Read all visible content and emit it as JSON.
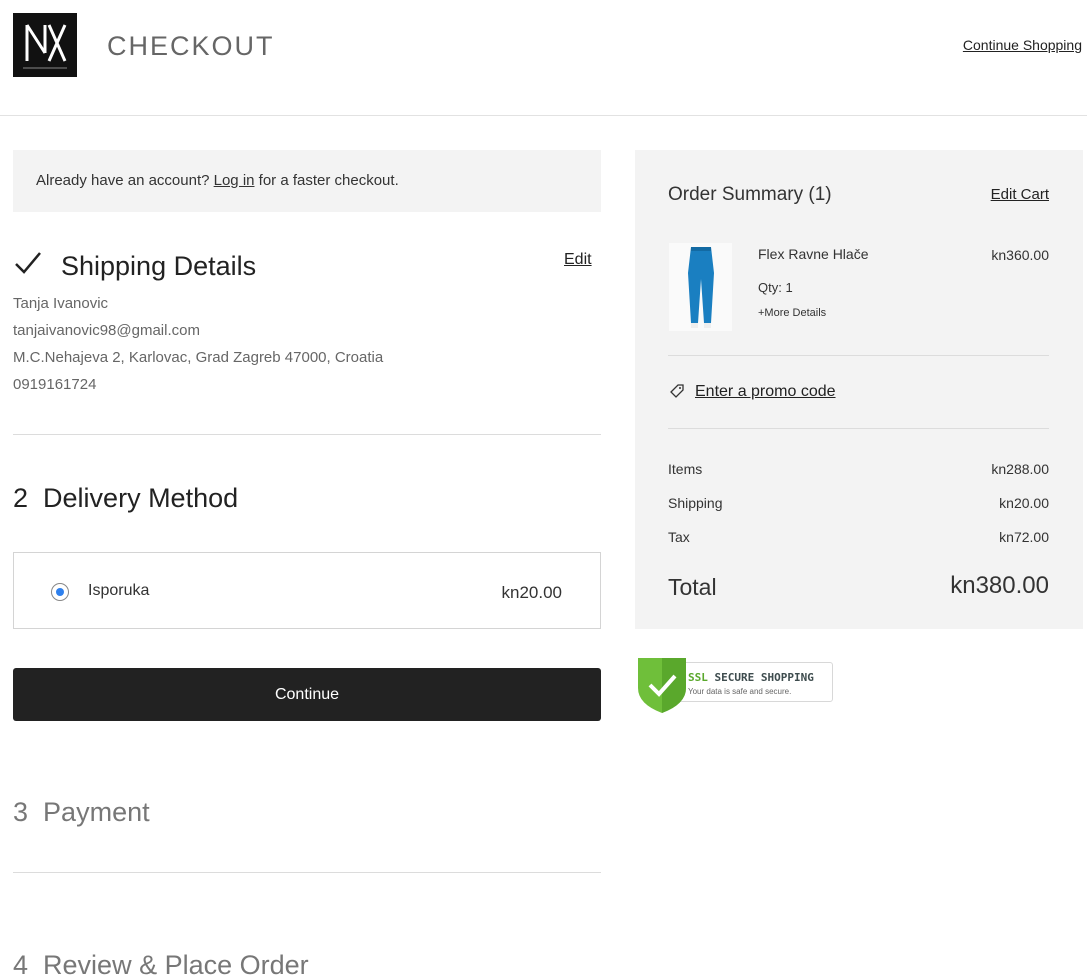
{
  "header": {
    "title": "CHECKOUT",
    "continue_shopping": "Continue Shopping"
  },
  "account": {
    "prefix": "Already have an account? ",
    "login": "Log in",
    "suffix": " for a faster checkout."
  },
  "shipping": {
    "title": "Shipping Details",
    "edit": "Edit",
    "name": "Tanja Ivanovic",
    "email": "tanjaivanovic98@gmail.com",
    "address": "M.C.Nehajeva 2, Karlovac, Grad Zagreb 47000, Croatia",
    "phone": "0919161724"
  },
  "delivery": {
    "step": "2",
    "title": "Delivery Method",
    "option_label": "Isporuka",
    "option_price": "kn20.00",
    "continue": "Continue"
  },
  "steps": {
    "payment": {
      "number": "3",
      "label": "Payment"
    },
    "review": {
      "number": "4",
      "label": "Review & Place Order"
    }
  },
  "summary": {
    "title": "Order Summary (1)",
    "edit_cart": "Edit Cart",
    "item": {
      "name": "Flex Ravne Hlače",
      "price": "kn360.00",
      "qty": "Qty: 1",
      "more": "+More Details"
    },
    "promo": "Enter a promo code",
    "rows": [
      {
        "label": "Items",
        "value": "kn288.00"
      },
      {
        "label": "Shipping",
        "value": "kn20.00"
      },
      {
        "label": "Tax",
        "value": "kn72.00"
      }
    ],
    "total_label": "Total",
    "total_value": "kn380.00"
  },
  "ssl": {
    "head_accent": "SSL",
    "head": " SECURE SHOPPING",
    "sub": "Your data is safe and secure."
  },
  "icons": {
    "logo": "brand-logo",
    "check": "check-icon",
    "tag": "tag-icon",
    "shield": "shield-check-icon"
  },
  "colors": {
    "primary_button": "#222222",
    "radio_selected": "#2f80ed",
    "panel_bg": "#f3f3f3",
    "ssl_green": "#5aa82c"
  }
}
